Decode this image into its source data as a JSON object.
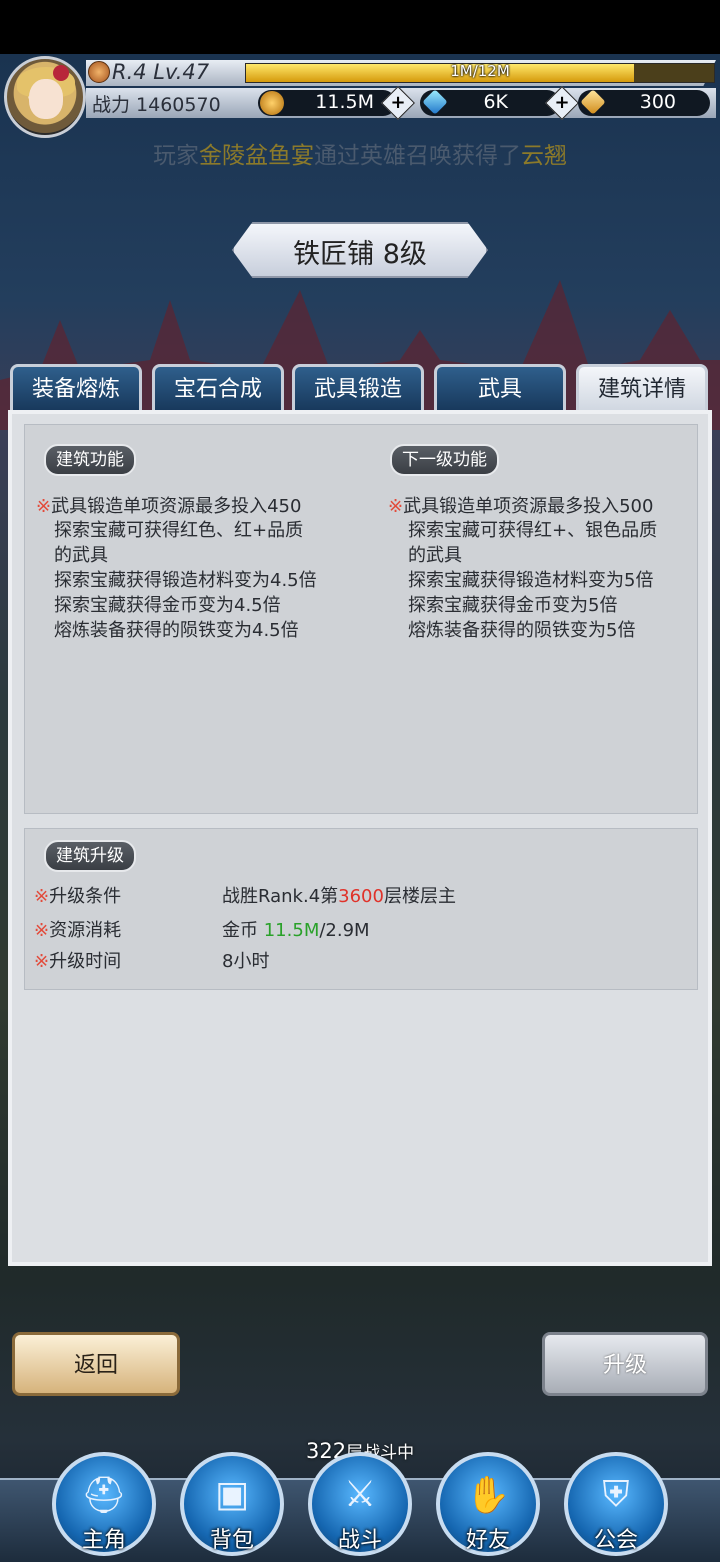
{
  "player": {
    "rank_level": "R.4 Lv.47",
    "exp_text": "1M/12M",
    "exp_fraction": 0.83,
    "power_label": "战力 1460570",
    "gold": "11.5M",
    "gems": "6K",
    "cards": "300"
  },
  "marquee": {
    "prefix": "玩家",
    "player_name": "金陵盆鱼宴",
    "middle": "通过英雄召唤获得了",
    "hero_name": "云翘"
  },
  "title": "铁匠铺 8级",
  "tabs": [
    "装备熔炼",
    "宝石合成",
    "武具锻造",
    "武具",
    "建筑详情"
  ],
  "current_function": {
    "header": "建筑功能",
    "mark": "※",
    "lines": [
      "武具锻造单项资源最多投入450",
      "探索宝藏可获得红色、红+品质",
      "的武具",
      "探索宝藏获得锻造材料变为4.5倍",
      "探索宝藏获得金币变为4.5倍",
      "熔炼装备获得的陨铁变为4.5倍"
    ]
  },
  "next_function": {
    "header": "下一级功能",
    "mark": "※",
    "lines": [
      "武具锻造单项资源最多投入500",
      "探索宝藏可获得红+、银色品质",
      "的武具",
      "探索宝藏获得锻造材料变为5倍",
      "探索宝藏获得金币变为5倍",
      "熔炼装备获得的陨铁变为5倍"
    ]
  },
  "upgrade": {
    "header": "建筑升级",
    "condition_label": "※升级条件",
    "condition_prefix": "战胜Rank.4第",
    "condition_floor": "3600",
    "condition_suffix": "层楼层主",
    "cost_label": "※资源消耗",
    "cost_prefix": "金币 ",
    "cost_have": "11.5M",
    "cost_need": "/2.9M",
    "time_label": "※升级时间",
    "time_value": "8小时"
  },
  "buttons": {
    "back": "返回",
    "upgrade": "升级"
  },
  "floor": {
    "number": "322",
    "unit": "层",
    "status": "战斗中"
  },
  "nav": [
    "主角",
    "背包",
    "战斗",
    "好友",
    "公会"
  ],
  "colors": {
    "warning_red": "#e0322a",
    "have_green": "#2aa12a",
    "tab_blue": "#2f5f8c"
  },
  "icons": [
    "rank-badge-icon",
    "gold-coin-icon",
    "gem-icon",
    "card-icon",
    "plus-icon",
    "helmet-icon",
    "bag-icon",
    "swords-icon",
    "handshake-icon",
    "shield-wings-icon"
  ]
}
